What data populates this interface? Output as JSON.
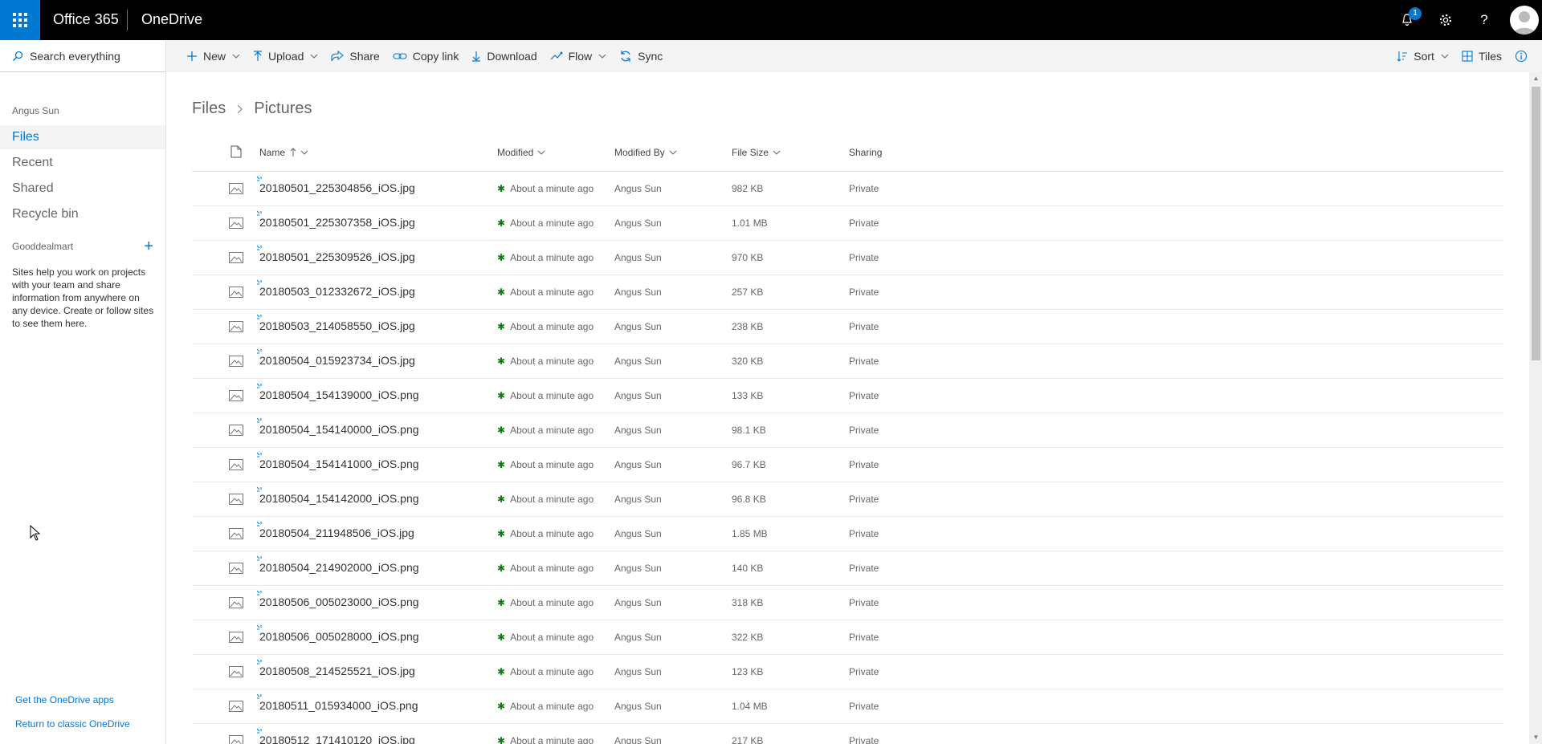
{
  "header": {
    "brand": "Office 365",
    "app_name": "OneDrive",
    "notification_count": "1"
  },
  "search": {
    "placeholder": "Search everything"
  },
  "nav": {
    "user": "Angus Sun",
    "items": [
      {
        "label": "Files",
        "active": true
      },
      {
        "label": "Recent",
        "active": false
      },
      {
        "label": "Shared",
        "active": false
      },
      {
        "label": "Recycle bin",
        "active": false
      }
    ],
    "sites_header": "Gooddealmart",
    "sites_text": "Sites help you work on projects with your team and share information from anywhere on any device. Create or follow sites to see them here.",
    "links": [
      "Get the OneDrive apps",
      "Return to classic OneDrive"
    ]
  },
  "toolbar": {
    "new": "New",
    "upload": "Upload",
    "share": "Share",
    "copy_link": "Copy link",
    "download": "Download",
    "flow": "Flow",
    "sync": "Sync",
    "sort": "Sort",
    "view": "Tiles"
  },
  "breadcrumb": [
    "Files",
    "Pictures"
  ],
  "columns": {
    "name": "Name",
    "modified": "Modified",
    "modified_by": "Modified By",
    "file_size": "File Size",
    "sharing": "Sharing"
  },
  "files": [
    {
      "name": "20180501_225304856_iOS.jpg",
      "modified": "About a minute ago",
      "modified_by": "Angus Sun",
      "size": "982 KB",
      "sharing": "Private"
    },
    {
      "name": "20180501_225307358_iOS.jpg",
      "modified": "About a minute ago",
      "modified_by": "Angus Sun",
      "size": "1.01 MB",
      "sharing": "Private"
    },
    {
      "name": "20180501_225309526_iOS.jpg",
      "modified": "About a minute ago",
      "modified_by": "Angus Sun",
      "size": "970 KB",
      "sharing": "Private"
    },
    {
      "name": "20180503_012332672_iOS.jpg",
      "modified": "About a minute ago",
      "modified_by": "Angus Sun",
      "size": "257 KB",
      "sharing": "Private"
    },
    {
      "name": "20180503_214058550_iOS.jpg",
      "modified": "About a minute ago",
      "modified_by": "Angus Sun",
      "size": "238 KB",
      "sharing": "Private"
    },
    {
      "name": "20180504_015923734_iOS.jpg",
      "modified": "About a minute ago",
      "modified_by": "Angus Sun",
      "size": "320 KB",
      "sharing": "Private"
    },
    {
      "name": "20180504_154139000_iOS.png",
      "modified": "About a minute ago",
      "modified_by": "Angus Sun",
      "size": "133 KB",
      "sharing": "Private"
    },
    {
      "name": "20180504_154140000_iOS.png",
      "modified": "About a minute ago",
      "modified_by": "Angus Sun",
      "size": "98.1 KB",
      "sharing": "Private"
    },
    {
      "name": "20180504_154141000_iOS.png",
      "modified": "About a minute ago",
      "modified_by": "Angus Sun",
      "size": "96.7 KB",
      "sharing": "Private"
    },
    {
      "name": "20180504_154142000_iOS.png",
      "modified": "About a minute ago",
      "modified_by": "Angus Sun",
      "size": "96.8 KB",
      "sharing": "Private"
    },
    {
      "name": "20180504_211948506_iOS.jpg",
      "modified": "About a minute ago",
      "modified_by": "Angus Sun",
      "size": "1.85 MB",
      "sharing": "Private"
    },
    {
      "name": "20180504_214902000_iOS.png",
      "modified": "About a minute ago",
      "modified_by": "Angus Sun",
      "size": "140 KB",
      "sharing": "Private"
    },
    {
      "name": "20180506_005023000_iOS.png",
      "modified": "About a minute ago",
      "modified_by": "Angus Sun",
      "size": "318 KB",
      "sharing": "Private"
    },
    {
      "name": "20180506_005028000_iOS.png",
      "modified": "About a minute ago",
      "modified_by": "Angus Sun",
      "size": "322 KB",
      "sharing": "Private"
    },
    {
      "name": "20180508_214525521_iOS.jpg",
      "modified": "About a minute ago",
      "modified_by": "Angus Sun",
      "size": "123 KB",
      "sharing": "Private"
    },
    {
      "name": "20180511_015934000_iOS.png",
      "modified": "About a minute ago",
      "modified_by": "Angus Sun",
      "size": "1.04 MB",
      "sharing": "Private"
    },
    {
      "name": "20180512_171410120_iOS.jpg",
      "modified": "About a minute ago",
      "modified_by": "Angus Sun",
      "size": "217 KB",
      "sharing": "Private"
    }
  ],
  "colors": {
    "accent": "#0078d4",
    "suitebar": "#000000",
    "new_marker": "#107c10"
  }
}
